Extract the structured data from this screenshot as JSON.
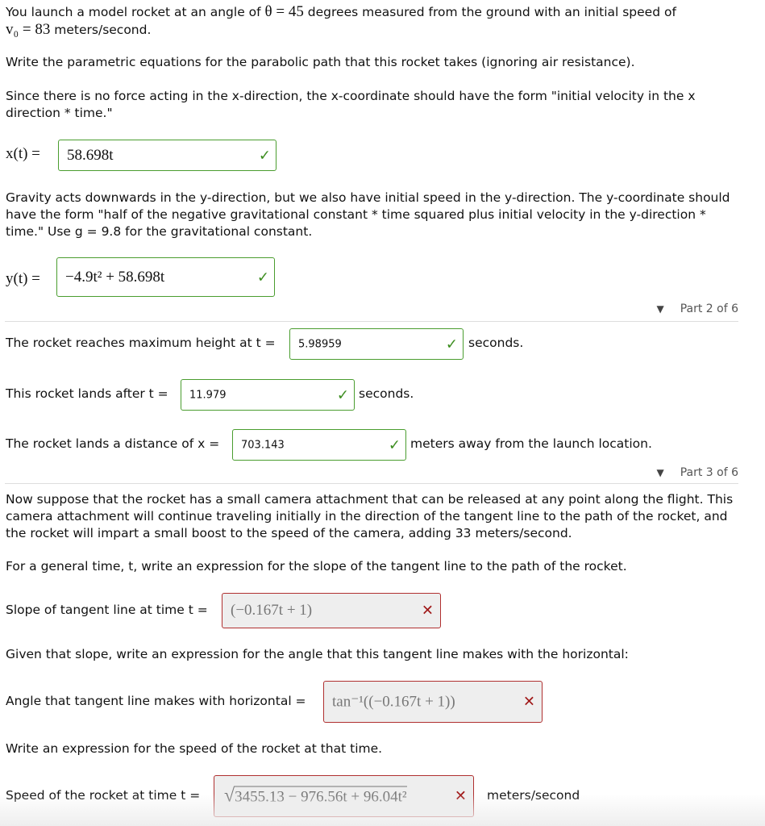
{
  "intro": {
    "line1_pre": "You launch a model rocket at an angle of ",
    "theta": "θ = 45",
    "line1_post": " degrees measured from the ground with an initial speed of",
    "v0": "v₀ = 83",
    "line2_post": " meters/second."
  },
  "prompt_parametric": "Write the parametric equations for the parabolic path that this rocket takes (ignoring air resistance).",
  "x_hint": "Since there is no force acting in the x-direction, the x-coordinate should have the form \"initial velocity in the x direction * time.\"",
  "x_label": "x(t) =",
  "x_answer": "58.698t",
  "y_hint": "Gravity acts downwards in the y-direction, but we also have initial speed in the y-direction. The y-coordinate should have the form \"half of the negative gravitational constant * time squared plus initial velocity in the y-direction * time.\" Use g = 9.8 for the gravitational constant.",
  "y_label": "y(t) =",
  "y_answer": "−4.9t² + 58.698t",
  "part2": "Part 2 of 6",
  "max_height": {
    "label": "The rocket reaches maximum height at t =",
    "value": "5.98959",
    "unit": "seconds."
  },
  "lands": {
    "label": "This rocket lands after t =",
    "value": "11.979",
    "unit": "seconds."
  },
  "distance": {
    "label": "The rocket lands a distance of x =",
    "value": "703.143",
    "unit": "meters away from the launch location."
  },
  "part3": "Part 3 of 6",
  "camera_text": "Now suppose that the rocket has a small camera attachment that can be released at any point along the flight. This camera attachment will continue traveling initially in the direction of the tangent line to the path of the rocket, and the rocket will impart a small boost to the speed of the camera, adding 33 meters/second.",
  "slope_prompt": "For a general time, t, write an expression for the slope of the tangent line to the path of the rocket.",
  "slope": {
    "label": "Slope of tangent line at time t =",
    "value": "(−0.167t + 1)"
  },
  "angle_prompt": "Given that slope, write an expression for the angle that this tangent line makes with the horizontal:",
  "angle": {
    "label": "Angle that tangent line makes with horizontal =",
    "value": "tan⁻¹((−0.167t + 1))"
  },
  "speed_prompt": "Write an expression for the speed of the rocket at that time.",
  "speed": {
    "label": "Speed of the rocket at time t =",
    "value": "3455.13 − 976.56t + 96.04t²",
    "unit": "meters/second"
  },
  "colors": {
    "correct": "#4a9d2f",
    "incorrect": "#b03030"
  }
}
